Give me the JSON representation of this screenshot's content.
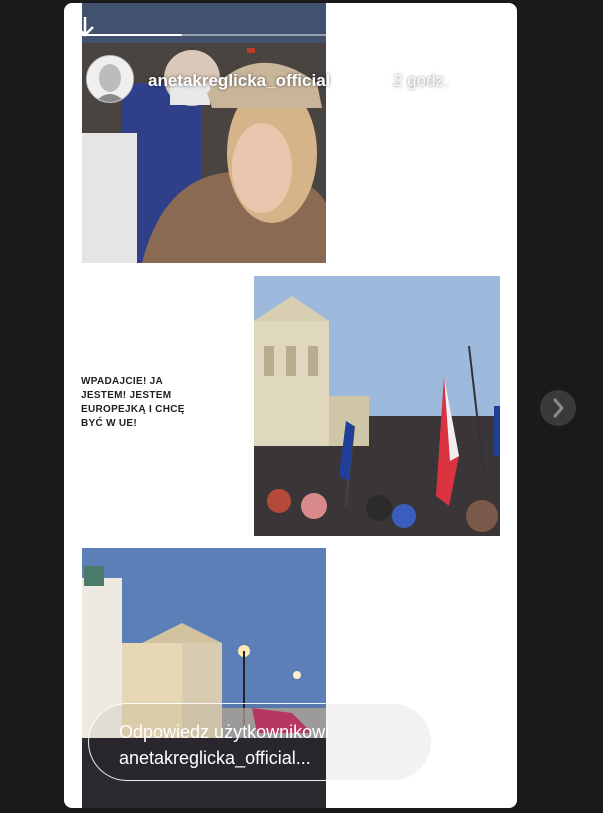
{
  "story": {
    "username": "anetakreglicka_official",
    "timestamp": "2 godz.",
    "progress": 0.25,
    "caption": "WPADAJCIE! JA JESTEM! JESTEM EUROPEJKĄ I CHCĘ BYĆ W UE!"
  },
  "reply": {
    "placeholder_line1": "Odpowiedz użytkownikowi",
    "placeholder_line2": "anetakreglicka_official..."
  },
  "icons": {
    "download": "download-arrow-icon",
    "pause": "pause-icon",
    "mute": "muted-speaker-icon",
    "more": "more-options-icon",
    "send": "send-icon",
    "next": "chevron-right-icon"
  }
}
